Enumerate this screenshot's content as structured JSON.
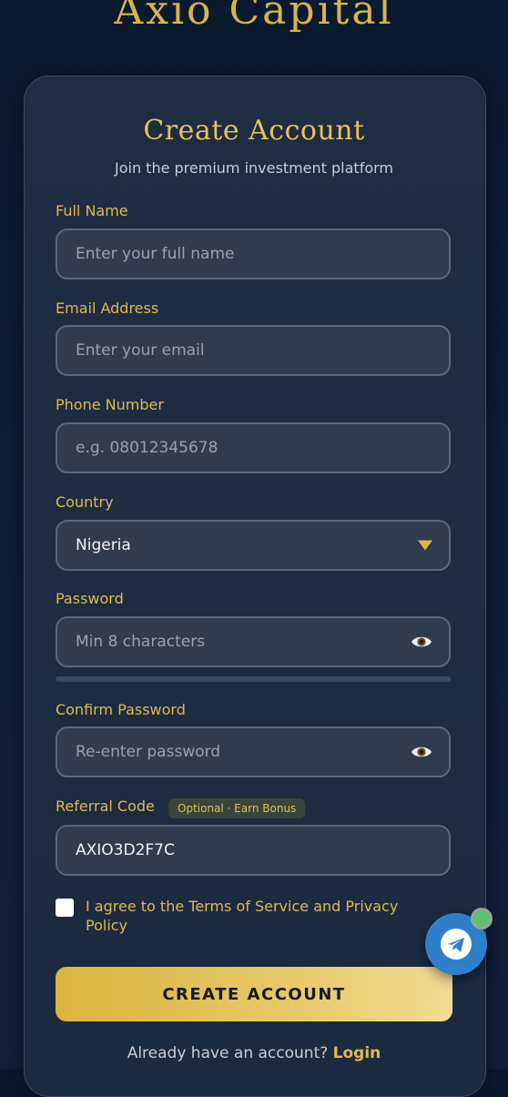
{
  "brand": "Axio Capital",
  "card": {
    "title": "Create Account",
    "subtitle": "Join the premium investment platform"
  },
  "form": {
    "full_name": {
      "label": "Full Name",
      "placeholder": "Enter your full name"
    },
    "email": {
      "label": "Email Address",
      "placeholder": "Enter your email"
    },
    "phone": {
      "label": "Phone Number",
      "placeholder": "e.g. 08012345678"
    },
    "country": {
      "label": "Country",
      "value": "Nigeria"
    },
    "password": {
      "label": "Password",
      "placeholder": "Min 8 characters"
    },
    "confirm_password": {
      "label": "Confirm Password",
      "placeholder": "Re-enter password"
    },
    "referral": {
      "label": "Referral Code",
      "badge": "Optional · Earn Bonus",
      "value": "AXIO3D2F7C"
    },
    "terms": {
      "text": "I agree to the Terms of Service and Privacy Policy"
    },
    "submit_label": "CREATE ACCOUNT"
  },
  "footer": {
    "prompt": "Already have an account?",
    "login_label": "Login"
  },
  "icons": {
    "eye": "eye-icon",
    "caret": "chevron-down-icon",
    "telegram": "telegram-icon"
  },
  "colors": {
    "accent": "#e3b84e",
    "background": "#0f1f38",
    "card": "#1f2c42"
  }
}
